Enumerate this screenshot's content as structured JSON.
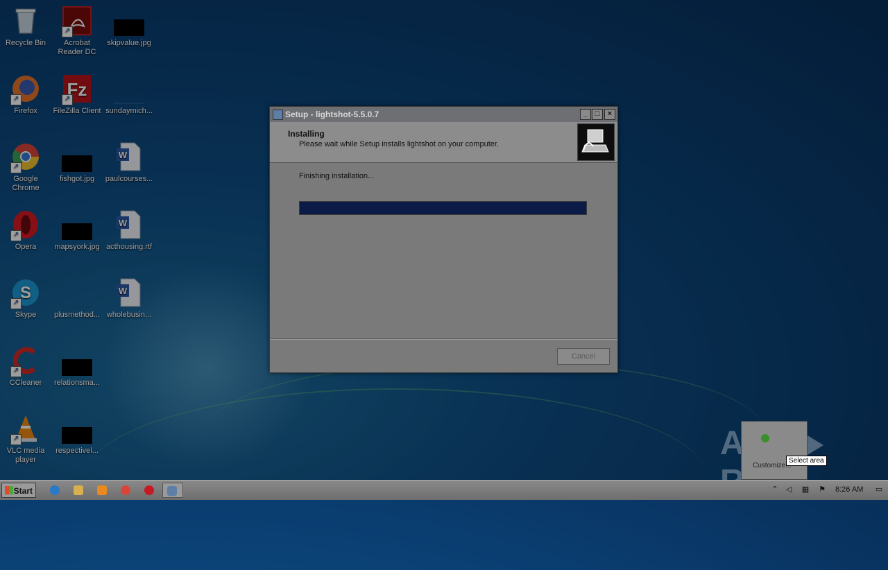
{
  "desktop": {
    "icons": [
      {
        "label": "Recycle Bin"
      },
      {
        "label": "Acrobat Reader DC"
      },
      {
        "label": "skipvalue.jpg"
      },
      {
        "label": "Firefox"
      },
      {
        "label": "FileZilla Client"
      },
      {
        "label": "sundaymich..."
      },
      {
        "label": "Google Chrome"
      },
      {
        "label": "fishgot.jpg"
      },
      {
        "label": "paulcourses..."
      },
      {
        "label": "Opera"
      },
      {
        "label": "mapsyork.jpg"
      },
      {
        "label": "acthousing.rtf"
      },
      {
        "label": "Skype"
      },
      {
        "label": "plusmethod..."
      },
      {
        "label": "wholebusin..."
      },
      {
        "label": "CCleaner"
      },
      {
        "label": "relationsma..."
      },
      {
        "label": "VLC media player"
      },
      {
        "label": "respectivel..."
      }
    ]
  },
  "dialog": {
    "title": "Setup - lightshot-5.5.0.7",
    "heading": "Installing",
    "subheading": "Please wait while Setup installs lightshot on your computer.",
    "status": "Finishing installation...",
    "progress": 1.0,
    "cancel_label": "Cancel",
    "min_glyph": "_",
    "max_glyph": "□",
    "close_glyph": "×"
  },
  "tray_popup": {
    "label": "Customize...",
    "tooltip": "Select area"
  },
  "watermark": {
    "left": "ANY",
    "right": "RUN"
  },
  "taskbar": {
    "start_label": "Start",
    "clock": "8:26 AM"
  },
  "colors": {
    "desktop_blue": "#0e4f86",
    "progress_fill": "#0b1b47"
  }
}
